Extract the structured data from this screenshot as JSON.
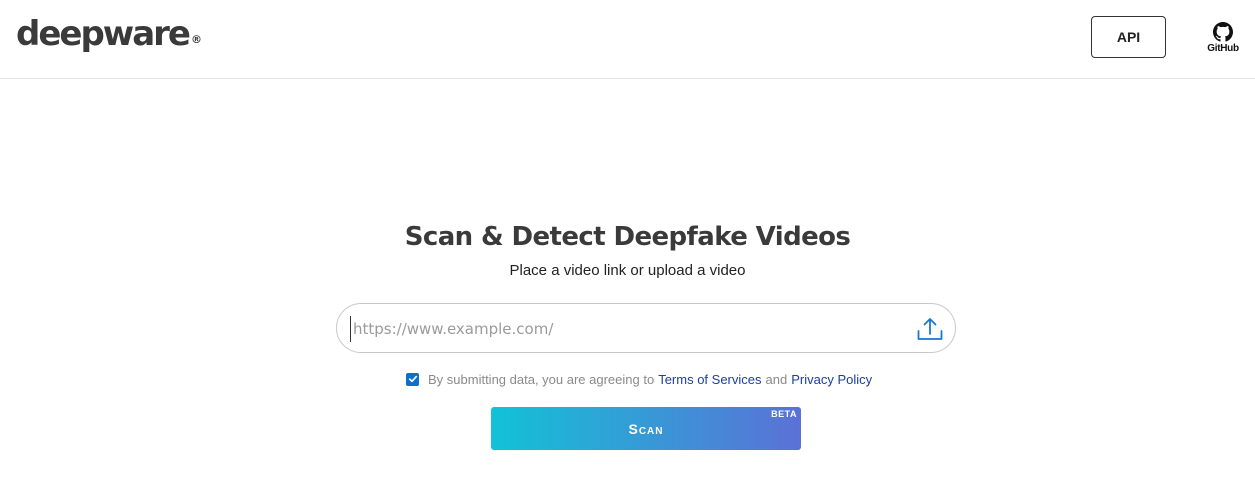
{
  "header": {
    "logo_text": "deepware",
    "logo_mark": "®",
    "api_label": "API",
    "github_label": "GitHub",
    "github_icon": "github-icon"
  },
  "main": {
    "title": "Scan & Detect Deepfake Videos",
    "subtitle": "Place a video link or upload a video",
    "url_input": {
      "value": "",
      "placeholder": "https://www.example.com/"
    },
    "upload_icon": "upload-icon",
    "consent": {
      "checked": true,
      "prefix": "By submitting data, you are agreeing to",
      "terms_link": "Terms of Services",
      "and_text": "and",
      "privacy_link": "Privacy Policy"
    },
    "scan_button": {
      "label": "Scan",
      "badge": "BETA",
      "gradient_start": "#12c2d6",
      "gradient_end": "#5b71d6"
    }
  },
  "colors": {
    "link": "#1a3fa0",
    "checkbox": "#0b6fd0",
    "upload_icon": "#1a78d0"
  }
}
